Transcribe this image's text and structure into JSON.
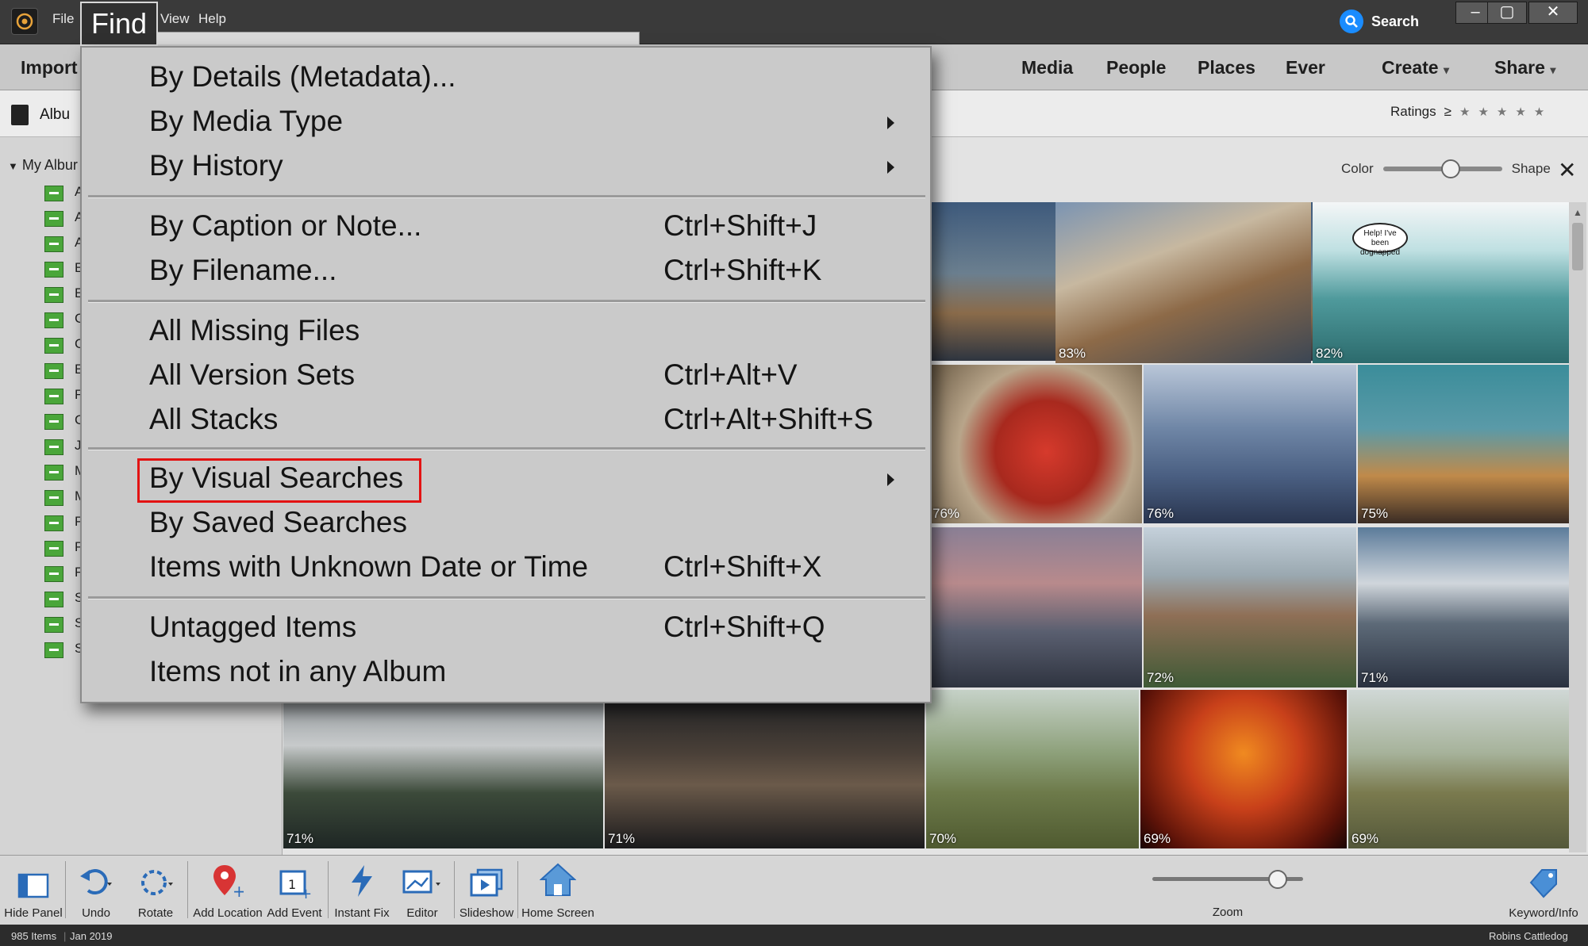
{
  "titlebar": {
    "menu": [
      "File",
      "Find",
      "View",
      "Help"
    ],
    "menu_view_partial": "View",
    "search_label": "Search",
    "window_buttons": [
      "–",
      "▢",
      "✕"
    ]
  },
  "nav": {
    "import": "Import",
    "tabs": [
      "Media",
      "People",
      "Places",
      "Ever"
    ],
    "create": "Create",
    "share": "Share"
  },
  "subbar": {
    "albums_tab": "Albu",
    "ratings_label": "Ratings",
    "ratings_op": "≥"
  },
  "left": {
    "my_albums": "My Albur",
    "albums": [
      "A",
      "A",
      "A",
      "E",
      "E",
      "C",
      "C",
      "E",
      "F",
      "C",
      "J",
      "M",
      "M",
      "P",
      "P",
      "F",
      "S",
      "S",
      "S"
    ]
  },
  "filter": {
    "color_label": "Color",
    "shape_label": "Shape",
    "similarity_slider": 0.55
  },
  "grid": {
    "thumbs": [
      {
        "pct": "83%"
      },
      {
        "pct": "82%"
      },
      {
        "pct": "76%"
      },
      {
        "pct": "76%"
      },
      {
        "pct": "75%"
      },
      {
        "pct": "72%"
      },
      {
        "pct": "71%"
      },
      {
        "pct": "71%"
      },
      {
        "pct": "71%"
      },
      {
        "pct": "70%"
      },
      {
        "pct": "69%"
      },
      {
        "pct": "69%"
      }
    ],
    "bubble_text": "Help! I've been dognapped"
  },
  "toolbar": {
    "hide_panel": "Hide Panel",
    "undo": "Undo",
    "rotate": "Rotate",
    "add_location": "Add Location",
    "add_event": "Add Event",
    "instant_fix": "Instant Fix",
    "editor": "Editor",
    "slideshow": "Slideshow",
    "home_screen": "Home Screen",
    "zoom": "Zoom",
    "zoom_level": 0.82,
    "keyword_info": "Keyword/Info"
  },
  "status": {
    "items": "985 Items",
    "date": "Jan 2019",
    "user": "Robins Cattledog"
  },
  "find_menu": {
    "ghost": "Details (Metadata)",
    "items": [
      {
        "label": "By Details (Metadata)...",
        "shortcut": ""
      },
      {
        "label": "By Media Type",
        "shortcut": ""
      },
      {
        "label": "By History",
        "shortcut": ""
      },
      {
        "label": "By Caption or Note...",
        "shortcut": "Ctrl+Shift+J"
      },
      {
        "label": "By Filename...",
        "shortcut": "Ctrl+Shift+K"
      },
      {
        "label": "All Missing Files",
        "shortcut": ""
      },
      {
        "label": "All Version Sets",
        "shortcut": "Ctrl+Alt+V"
      },
      {
        "label": "All Stacks",
        "shortcut": "Ctrl+Alt+Shift+S"
      },
      {
        "label": "By Visual Searches",
        "shortcut": ""
      },
      {
        "label": "By Saved Searches",
        "shortcut": ""
      },
      {
        "label": "Items with Unknown Date or Time",
        "shortcut": "Ctrl+Shift+X"
      },
      {
        "label": "Untagged Items",
        "shortcut": "Ctrl+Shift+Q"
      },
      {
        "label": "Items not in any Album",
        "shortcut": ""
      }
    ]
  },
  "colors": {
    "highlight": "#e31313",
    "search_accent": "#1a8cff",
    "album_icon": "#4aa63a"
  }
}
